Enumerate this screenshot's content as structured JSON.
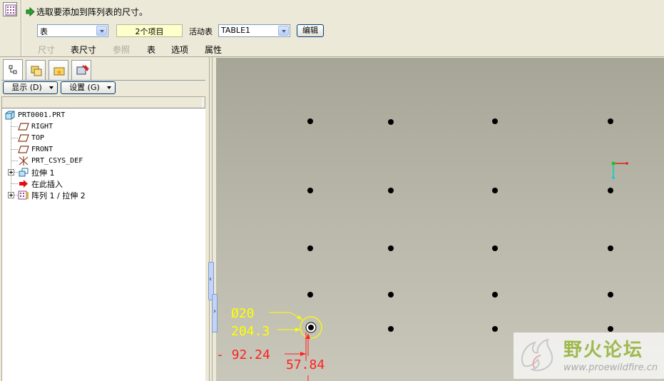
{
  "dashboard": {
    "prompt": "选取要添加到阵列表的尺寸。",
    "table_select": "表",
    "items_count": "2个项目",
    "active_table_label": "活动表",
    "active_table": "TABLE1",
    "edit_button": "编辑",
    "tabs": [
      {
        "label": "尺寸",
        "enabled": false
      },
      {
        "label": "表尺寸",
        "enabled": true
      },
      {
        "label": "参照",
        "enabled": false
      },
      {
        "label": "表",
        "enabled": true
      },
      {
        "label": "选项",
        "enabled": true
      },
      {
        "label": "属性",
        "enabled": true
      }
    ]
  },
  "navigator": {
    "display_button": "显示 (D)",
    "settings_button": "设置 (G)",
    "tree": [
      {
        "label": "PRT0001.PRT",
        "icon": "part-icon"
      },
      {
        "label": "RIGHT",
        "icon": "datum-plane-icon"
      },
      {
        "label": "TOP",
        "icon": "datum-plane-icon"
      },
      {
        "label": "FRONT",
        "icon": "datum-plane-icon"
      },
      {
        "label": "PRT_CSYS_DEF",
        "icon": "coordinate-system-icon"
      },
      {
        "label": "拉伸 1",
        "icon": "extrude-icon"
      },
      {
        "label": "在此插入",
        "icon": "insert-here-arrow-icon"
      },
      {
        "label": "阵列 1 / 拉伸 2",
        "icon": "pattern-icon"
      }
    ]
  },
  "graphics": {
    "dimensions": {
      "diameter": "Ø20",
      "vertical_spacing": "204.3",
      "horizontal_offset": "- 92.24",
      "vertical_offset": "57.84"
    },
    "colors": {
      "selected_dim": "#ffff00",
      "dim": "#ff2020",
      "hole": "#000000"
    }
  },
  "watermark": {
    "title": "野火论坛",
    "url": "www.proewildfire.cn"
  }
}
